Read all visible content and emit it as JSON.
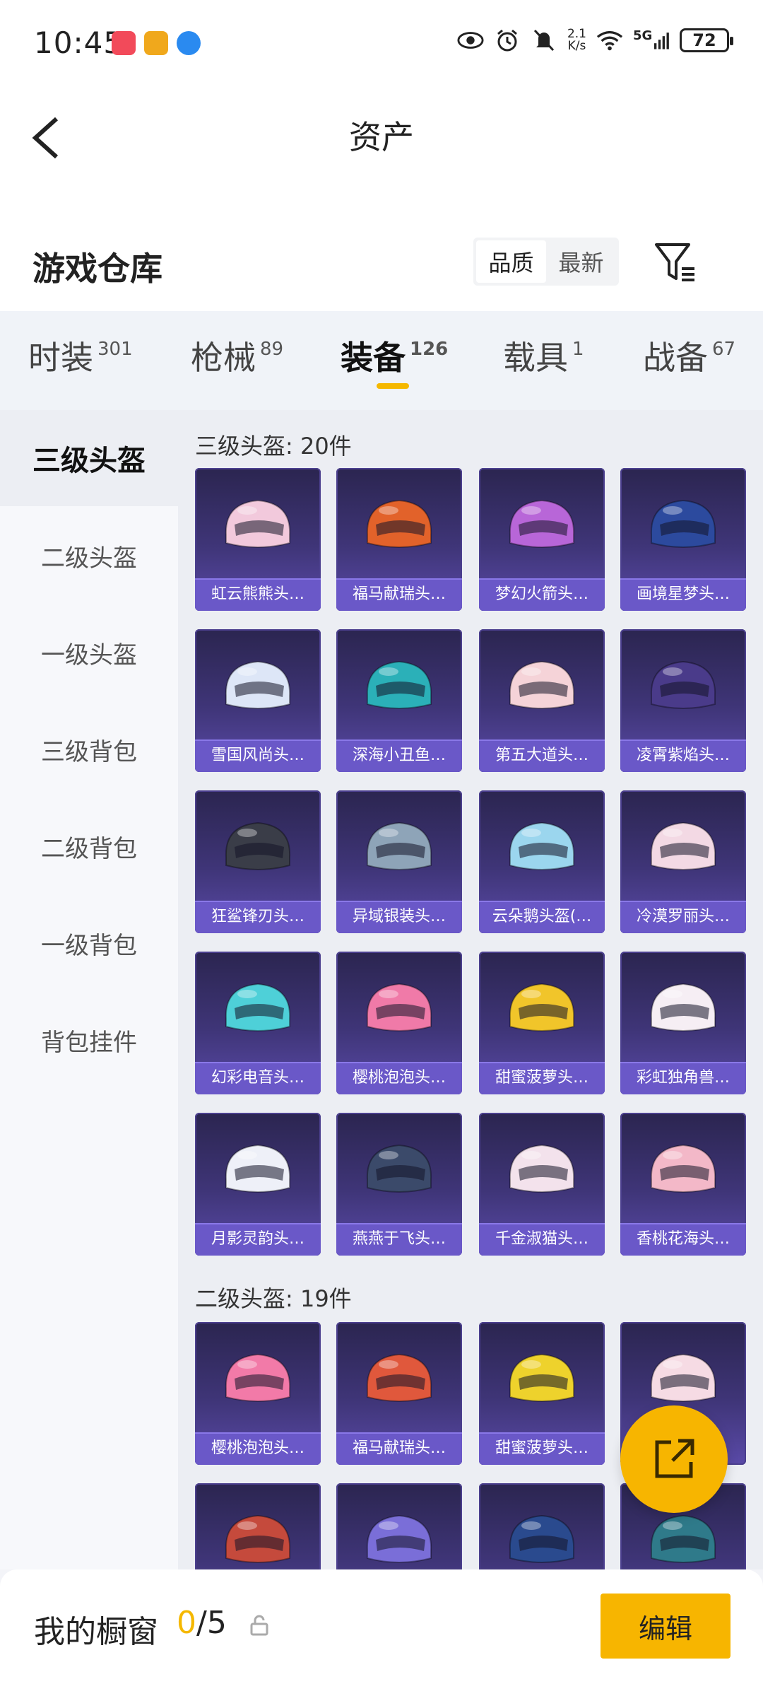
{
  "status_bar": {
    "time": "10:45",
    "net_speed_value": "2.1",
    "net_speed_unit": "K/s",
    "network": "5G",
    "battery": "72"
  },
  "header": {
    "title": "资产"
  },
  "warehouse": {
    "title": "游戏仓库",
    "sort_options": [
      "品质",
      "最新"
    ],
    "sort_selected": "品质"
  },
  "tabs": [
    {
      "label": "时装",
      "count": "301"
    },
    {
      "label": "枪械",
      "count": "89"
    },
    {
      "label": "装备",
      "count": "126"
    },
    {
      "label": "载具",
      "count": "1"
    },
    {
      "label": "战备",
      "count": "67"
    }
  ],
  "active_tab": "装备",
  "sidebar": [
    "三级头盔",
    "二级头盔",
    "一级头盔",
    "三级背包",
    "二级背包",
    "一级背包",
    "背包挂件"
  ],
  "groups": [
    {
      "heading": "三级头盔: 20件",
      "items": [
        "虹云熊熊头…",
        "福马献瑞头…",
        "梦幻火箭头…",
        "画境星梦头…",
        "雪国风尚头…",
        "深海小丑鱼…",
        "第五大道头…",
        "凌霄紫焰头…",
        "狂鲨锋刃头…",
        "异域银装头…",
        "云朵鹅头盔(…",
        "冷漠罗丽头…",
        "幻彩电音头…",
        "樱桃泡泡头…",
        "甜蜜菠萝头…",
        "彩虹独角兽…",
        "月影灵韵头…",
        "燕燕于飞头…",
        "千金淑猫头…",
        "香桃花海头…"
      ]
    },
    {
      "heading": "二级头盔: 19件",
      "items": [
        "樱桃泡泡头…",
        "福马献瑞头…",
        "甜蜜菠萝头…",
        "",
        "",
        "",
        "",
        ""
      ]
    }
  ],
  "colors": {
    "accent": "#f7b500",
    "card_top": "#2b2550",
    "card_bottom": "#5a4aa8",
    "card_label": "#6a58c8"
  },
  "helmet_colors": [
    "#f2c9dc",
    "#e2622a",
    "#b866d8",
    "#2c4a9e",
    "#dde6f7",
    "#2bb0b8",
    "#f5d3d8",
    "#4a3b8a",
    "#3a3d48",
    "#8ea4b8",
    "#9bd6ee",
    "#f3d9e4",
    "#4ed0d8",
    "#f07aa8",
    "#f1c52a",
    "#f6eef4",
    "#eef0f8",
    "#3b4a6a",
    "#f3e2ec",
    "#f3b8c8",
    "#f27aa8",
    "#e0583c",
    "#eed22c",
    "#f6dbe4",
    "#c54a3c",
    "#7a6ed8",
    "#2a4a8e",
    "#2f7a8a"
  ],
  "bottom_bar": {
    "label": "我的橱窗",
    "count_current": "0",
    "count_sep_total": "/5",
    "edit_label": "编辑"
  }
}
